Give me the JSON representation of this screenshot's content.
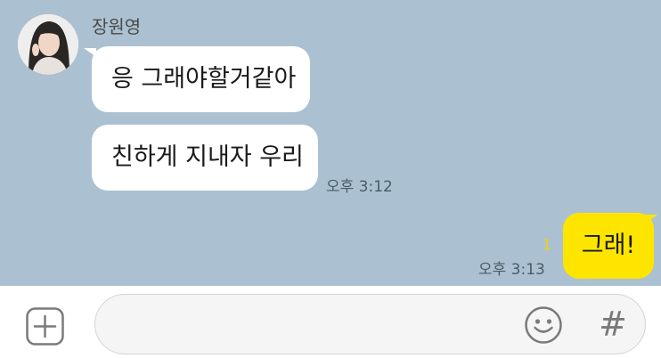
{
  "chat": {
    "sender_name": "장원영",
    "messages_in": [
      {
        "text": "응 그래야할거같아"
      },
      {
        "text": "친하게 지내자 우리"
      }
    ],
    "in_time": "오후 3:12",
    "messages_out": [
      {
        "text": "그래!",
        "unread": "1",
        "time": "오후 3:13"
      }
    ]
  },
  "input": {
    "plus_icon": "plus-square-icon",
    "emoji_icon": "smiley-icon",
    "hash_label": "#"
  },
  "colors": {
    "chat_background": "#abc1d1",
    "incoming_bubble": "#ffffff",
    "outgoing_bubble": "#fee500",
    "unread_count": "#f4d000"
  }
}
